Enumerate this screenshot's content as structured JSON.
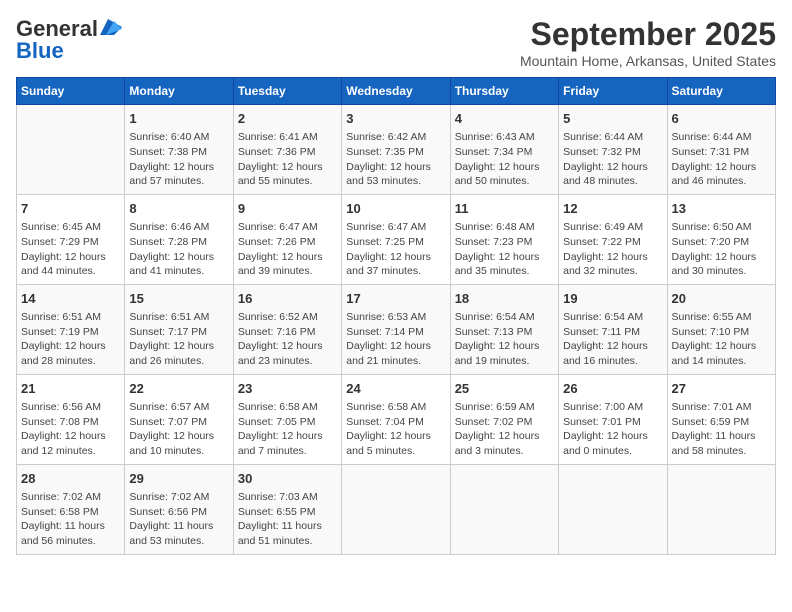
{
  "header": {
    "logo_line1": "General",
    "logo_line2": "Blue",
    "title": "September 2025",
    "subtitle": "Mountain Home, Arkansas, United States"
  },
  "weekdays": [
    "Sunday",
    "Monday",
    "Tuesday",
    "Wednesday",
    "Thursday",
    "Friday",
    "Saturday"
  ],
  "weeks": [
    [
      {
        "day": "",
        "info": ""
      },
      {
        "day": "1",
        "info": "Sunrise: 6:40 AM\nSunset: 7:38 PM\nDaylight: 12 hours and 57 minutes."
      },
      {
        "day": "2",
        "info": "Sunrise: 6:41 AM\nSunset: 7:36 PM\nDaylight: 12 hours and 55 minutes."
      },
      {
        "day": "3",
        "info": "Sunrise: 6:42 AM\nSunset: 7:35 PM\nDaylight: 12 hours and 53 minutes."
      },
      {
        "day": "4",
        "info": "Sunrise: 6:43 AM\nSunset: 7:34 PM\nDaylight: 12 hours and 50 minutes."
      },
      {
        "day": "5",
        "info": "Sunrise: 6:44 AM\nSunset: 7:32 PM\nDaylight: 12 hours and 48 minutes."
      },
      {
        "day": "6",
        "info": "Sunrise: 6:44 AM\nSunset: 7:31 PM\nDaylight: 12 hours and 46 minutes."
      }
    ],
    [
      {
        "day": "7",
        "info": "Sunrise: 6:45 AM\nSunset: 7:29 PM\nDaylight: 12 hours and 44 minutes."
      },
      {
        "day": "8",
        "info": "Sunrise: 6:46 AM\nSunset: 7:28 PM\nDaylight: 12 hours and 41 minutes."
      },
      {
        "day": "9",
        "info": "Sunrise: 6:47 AM\nSunset: 7:26 PM\nDaylight: 12 hours and 39 minutes."
      },
      {
        "day": "10",
        "info": "Sunrise: 6:47 AM\nSunset: 7:25 PM\nDaylight: 12 hours and 37 minutes."
      },
      {
        "day": "11",
        "info": "Sunrise: 6:48 AM\nSunset: 7:23 PM\nDaylight: 12 hours and 35 minutes."
      },
      {
        "day": "12",
        "info": "Sunrise: 6:49 AM\nSunset: 7:22 PM\nDaylight: 12 hours and 32 minutes."
      },
      {
        "day": "13",
        "info": "Sunrise: 6:50 AM\nSunset: 7:20 PM\nDaylight: 12 hours and 30 minutes."
      }
    ],
    [
      {
        "day": "14",
        "info": "Sunrise: 6:51 AM\nSunset: 7:19 PM\nDaylight: 12 hours and 28 minutes."
      },
      {
        "day": "15",
        "info": "Sunrise: 6:51 AM\nSunset: 7:17 PM\nDaylight: 12 hours and 26 minutes."
      },
      {
        "day": "16",
        "info": "Sunrise: 6:52 AM\nSunset: 7:16 PM\nDaylight: 12 hours and 23 minutes."
      },
      {
        "day": "17",
        "info": "Sunrise: 6:53 AM\nSunset: 7:14 PM\nDaylight: 12 hours and 21 minutes."
      },
      {
        "day": "18",
        "info": "Sunrise: 6:54 AM\nSunset: 7:13 PM\nDaylight: 12 hours and 19 minutes."
      },
      {
        "day": "19",
        "info": "Sunrise: 6:54 AM\nSunset: 7:11 PM\nDaylight: 12 hours and 16 minutes."
      },
      {
        "day": "20",
        "info": "Sunrise: 6:55 AM\nSunset: 7:10 PM\nDaylight: 12 hours and 14 minutes."
      }
    ],
    [
      {
        "day": "21",
        "info": "Sunrise: 6:56 AM\nSunset: 7:08 PM\nDaylight: 12 hours and 12 minutes."
      },
      {
        "day": "22",
        "info": "Sunrise: 6:57 AM\nSunset: 7:07 PM\nDaylight: 12 hours and 10 minutes."
      },
      {
        "day": "23",
        "info": "Sunrise: 6:58 AM\nSunset: 7:05 PM\nDaylight: 12 hours and 7 minutes."
      },
      {
        "day": "24",
        "info": "Sunrise: 6:58 AM\nSunset: 7:04 PM\nDaylight: 12 hours and 5 minutes."
      },
      {
        "day": "25",
        "info": "Sunrise: 6:59 AM\nSunset: 7:02 PM\nDaylight: 12 hours and 3 minutes."
      },
      {
        "day": "26",
        "info": "Sunrise: 7:00 AM\nSunset: 7:01 PM\nDaylight: 12 hours and 0 minutes."
      },
      {
        "day": "27",
        "info": "Sunrise: 7:01 AM\nSunset: 6:59 PM\nDaylight: 11 hours and 58 minutes."
      }
    ],
    [
      {
        "day": "28",
        "info": "Sunrise: 7:02 AM\nSunset: 6:58 PM\nDaylight: 11 hours and 56 minutes."
      },
      {
        "day": "29",
        "info": "Sunrise: 7:02 AM\nSunset: 6:56 PM\nDaylight: 11 hours and 53 minutes."
      },
      {
        "day": "30",
        "info": "Sunrise: 7:03 AM\nSunset: 6:55 PM\nDaylight: 11 hours and 51 minutes."
      },
      {
        "day": "",
        "info": ""
      },
      {
        "day": "",
        "info": ""
      },
      {
        "day": "",
        "info": ""
      },
      {
        "day": "",
        "info": ""
      }
    ]
  ]
}
